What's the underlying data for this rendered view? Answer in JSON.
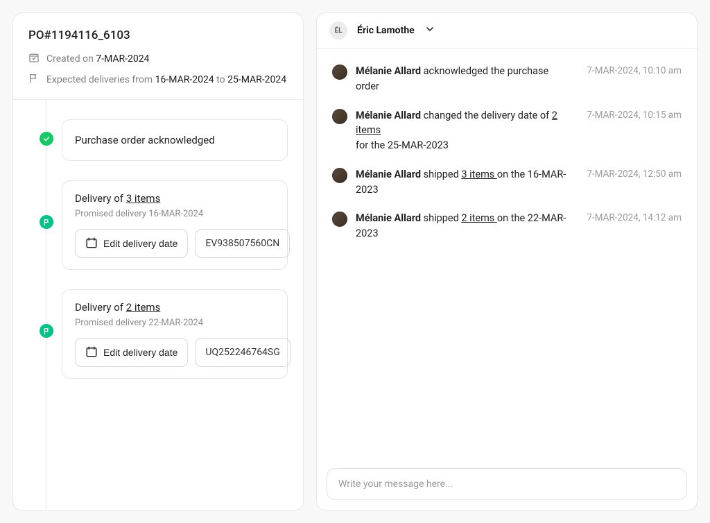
{
  "po": {
    "title": "PO#1194116_6103",
    "created_label": "Created on",
    "created_date": "7-MAR-2024",
    "expected_label_prefix": "Expected deliveries from",
    "expected_from": "16-MAR-2024",
    "expected_to_word": "to",
    "expected_to": "25-MAR-2024"
  },
  "timeline": {
    "ack": "Purchase order acknowledged",
    "edit_button": "Edit delivery date",
    "deliveries": [
      {
        "title_prefix": "Delivery of",
        "items_text": "3 items",
        "promised_label": "Promised delivery",
        "promised_date": "16-MAR-2024",
        "tracking": "EV938507560CN"
      },
      {
        "title_prefix": "Delivery of",
        "items_text": "2 items",
        "promised_label": "Promised delivery",
        "promised_date": "22-MAR-2024",
        "tracking": "UQ252246764SG"
      }
    ]
  },
  "user": {
    "initials": "ÉL",
    "name": "Éric Lamothe"
  },
  "feed": [
    {
      "actor": "Mélanie Allard",
      "text_before_link": " acknowledged the purchase order",
      "link": "",
      "text_after_link": "",
      "line2": "",
      "time": "7-MAR-2024, 10:10 am"
    },
    {
      "actor": "Mélanie Allard",
      "text_before_link": " changed the delivery date of ",
      "link": "2 items ",
      "text_after_link": "",
      "line2": "for the 25-MAR-2023",
      "time": "7-MAR-2024, 10:15 am"
    },
    {
      "actor": "Mélanie Allard",
      "text_before_link": " shipped ",
      "link": "3 items ",
      "text_after_link": " on the 16-MAR-2023",
      "line2": "",
      "time": "7-MAR-2024, 12:50 am"
    },
    {
      "actor": "Mélanie Allard",
      "text_before_link": " shipped ",
      "link": "2 items ",
      "text_after_link": " on the 22-MAR-2023",
      "line2": "",
      "time": "7-MAR-2024, 14:12 am"
    }
  ],
  "composer": {
    "placeholder": "Write your message here..."
  }
}
